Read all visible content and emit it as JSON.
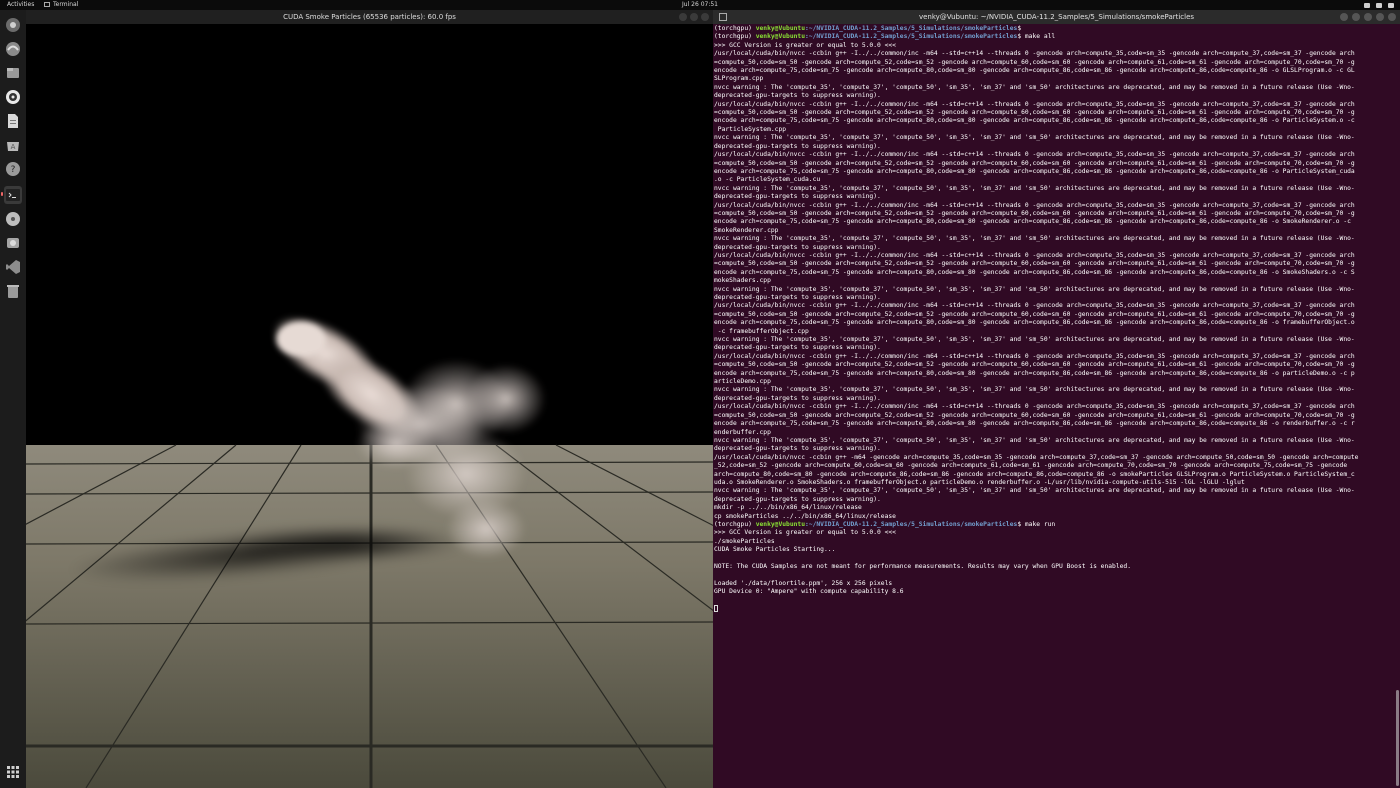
{
  "topbar": {
    "activities": "Activities",
    "app_name": "Terminal",
    "clock": "Jul 26  07:51"
  },
  "dock": {
    "items": [
      "chrome-icon",
      "browser-icon",
      "files-icon",
      "rhythmbox-icon",
      "writer-icon",
      "software-icon",
      "help-icon",
      "terminal-icon",
      "disc-icon",
      "drive-icon",
      "vscode-icon",
      "trash-icon"
    ],
    "show_apps": "show-apps-icon"
  },
  "smoke_window": {
    "title": "CUDA Smoke Particles (65536 particles): 60.0 fps"
  },
  "terminal": {
    "title": "venky@Vubuntu: ~/NVIDIA_CUDA-11.2_Samples/5_Simulations/smokeParticles",
    "lines": [
      {
        "type": "prompt",
        "env": "(torchgpu) ",
        "user": "venky@Vubuntu",
        "path": ":~/NVIDIA_CUDA-11.2_Samples/5_Simulations/smokeParticles",
        "cmd": "$ "
      },
      {
        "type": "prompt",
        "env": "(torchgpu) ",
        "user": "venky@Vubuntu",
        "path": ":~/NVIDIA_CUDA-11.2_Samples/5_Simulations/smokeParticles",
        "cmd": "$ make all"
      },
      {
        "type": "text",
        "text": ">>> GCC Version is greater or equal to 5.0.0 <<<"
      },
      {
        "type": "text",
        "text": "/usr/local/cuda/bin/nvcc -ccbin g++ -I../../common/inc -m64 --std=c++14 --threads 0 -gencode arch=compute_35,code=sm_35 -gencode arch=compute_37,code=sm_37 -gencode arch"
      },
      {
        "type": "text",
        "text": "=compute_50,code=sm_50 -gencode arch=compute_52,code=sm_52 -gencode arch=compute_60,code=sm_60 -gencode arch=compute_61,code=sm_61 -gencode arch=compute_70,code=sm_70 -g"
      },
      {
        "type": "text",
        "text": "encode arch=compute_75,code=sm_75 -gencode arch=compute_80,code=sm_80 -gencode arch=compute_86,code=sm_86 -gencode arch=compute_86,code=compute_86 -o GLSLProgram.o -c GL"
      },
      {
        "type": "text",
        "text": "SLProgram.cpp"
      },
      {
        "type": "text",
        "text": "nvcc warning : The 'compute_35', 'compute_37', 'compute_50', 'sm_35', 'sm_37' and 'sm_50' architectures are deprecated, and may be removed in a future release (Use -Wno-"
      },
      {
        "type": "text",
        "text": "deprecated-gpu-targets to suppress warning)."
      },
      {
        "type": "text",
        "text": "/usr/local/cuda/bin/nvcc -ccbin g++ -I../../common/inc -m64 --std=c++14 --threads 0 -gencode arch=compute_35,code=sm_35 -gencode arch=compute_37,code=sm_37 -gencode arch"
      },
      {
        "type": "text",
        "text": "=compute_50,code=sm_50 -gencode arch=compute_52,code=sm_52 -gencode arch=compute_60,code=sm_60 -gencode arch=compute_61,code=sm_61 -gencode arch=compute_70,code=sm_70 -g"
      },
      {
        "type": "text",
        "text": "encode arch=compute_75,code=sm_75 -gencode arch=compute_80,code=sm_80 -gencode arch=compute_86,code=sm_86 -gencode arch=compute_86,code=compute_86 -o ParticleSystem.o -c"
      },
      {
        "type": "text",
        "text": " ParticleSystem.cpp"
      },
      {
        "type": "text",
        "text": "nvcc warning : The 'compute_35', 'compute_37', 'compute_50', 'sm_35', 'sm_37' and 'sm_50' architectures are deprecated, and may be removed in a future release (Use -Wno-"
      },
      {
        "type": "text",
        "text": "deprecated-gpu-targets to suppress warning)."
      },
      {
        "type": "text",
        "text": "/usr/local/cuda/bin/nvcc -ccbin g++ -I../../common/inc -m64 --std=c++14 --threads 0 -gencode arch=compute_35,code=sm_35 -gencode arch=compute_37,code=sm_37 -gencode arch"
      },
      {
        "type": "text",
        "text": "=compute_50,code=sm_50 -gencode arch=compute_52,code=sm_52 -gencode arch=compute_60,code=sm_60 -gencode arch=compute_61,code=sm_61 -gencode arch=compute_70,code=sm_70 -g"
      },
      {
        "type": "text",
        "text": "encode arch=compute_75,code=sm_75 -gencode arch=compute_80,code=sm_80 -gencode arch=compute_86,code=sm_86 -gencode arch=compute_86,code=compute_86 -o ParticleSystem_cuda"
      },
      {
        "type": "text",
        "text": ".o -c ParticleSystem_cuda.cu"
      },
      {
        "type": "text",
        "text": "nvcc warning : The 'compute_35', 'compute_37', 'compute_50', 'sm_35', 'sm_37' and 'sm_50' architectures are deprecated, and may be removed in a future release (Use -Wno-"
      },
      {
        "type": "text",
        "text": "deprecated-gpu-targets to suppress warning)."
      },
      {
        "type": "text",
        "text": "/usr/local/cuda/bin/nvcc -ccbin g++ -I../../common/inc -m64 --std=c++14 --threads 0 -gencode arch=compute_35,code=sm_35 -gencode arch=compute_37,code=sm_37 -gencode arch"
      },
      {
        "type": "text",
        "text": "=compute_50,code=sm_50 -gencode arch=compute_52,code=sm_52 -gencode arch=compute_60,code=sm_60 -gencode arch=compute_61,code=sm_61 -gencode arch=compute_70,code=sm_70 -g"
      },
      {
        "type": "text",
        "text": "encode arch=compute_75,code=sm_75 -gencode arch=compute_80,code=sm_80 -gencode arch=compute_86,code=sm_86 -gencode arch=compute_86,code=compute_86 -o SmokeRenderer.o -c"
      },
      {
        "type": "text",
        "text": "SmokeRenderer.cpp"
      },
      {
        "type": "text",
        "text": "nvcc warning : The 'compute_35', 'compute_37', 'compute_50', 'sm_35', 'sm_37' and 'sm_50' architectures are deprecated, and may be removed in a future release (Use -Wno-"
      },
      {
        "type": "text",
        "text": "deprecated-gpu-targets to suppress warning)."
      },
      {
        "type": "text",
        "text": "/usr/local/cuda/bin/nvcc -ccbin g++ -I../../common/inc -m64 --std=c++14 --threads 0 -gencode arch=compute_35,code=sm_35 -gencode arch=compute_37,code=sm_37 -gencode arch"
      },
      {
        "type": "text",
        "text": "=compute_50,code=sm_50 -gencode arch=compute_52,code=sm_52 -gencode arch=compute_60,code=sm_60 -gencode arch=compute_61,code=sm_61 -gencode arch=compute_70,code=sm_70 -g"
      },
      {
        "type": "text",
        "text": "encode arch=compute_75,code=sm_75 -gencode arch=compute_80,code=sm_80 -gencode arch=compute_86,code=sm_86 -gencode arch=compute_86,code=compute_86 -o SmokeShaders.o -c S"
      },
      {
        "type": "text",
        "text": "mokeShaders.cpp"
      },
      {
        "type": "text",
        "text": "nvcc warning : The 'compute_35', 'compute_37', 'compute_50', 'sm_35', 'sm_37' and 'sm_50' architectures are deprecated, and may be removed in a future release (Use -Wno-"
      },
      {
        "type": "text",
        "text": "deprecated-gpu-targets to suppress warning)."
      },
      {
        "type": "text",
        "text": "/usr/local/cuda/bin/nvcc -ccbin g++ -I../../common/inc -m64 --std=c++14 --threads 0 -gencode arch=compute_35,code=sm_35 -gencode arch=compute_37,code=sm_37 -gencode arch"
      },
      {
        "type": "text",
        "text": "=compute_50,code=sm_50 -gencode arch=compute_52,code=sm_52 -gencode arch=compute_60,code=sm_60 -gencode arch=compute_61,code=sm_61 -gencode arch=compute_70,code=sm_70 -g"
      },
      {
        "type": "text",
        "text": "encode arch=compute_75,code=sm_75 -gencode arch=compute_80,code=sm_80 -gencode arch=compute_86,code=sm_86 -gencode arch=compute_86,code=compute_86 -o framebufferObject.o"
      },
      {
        "type": "text",
        "text": " -c framebufferObject.cpp"
      },
      {
        "type": "text",
        "text": "nvcc warning : The 'compute_35', 'compute_37', 'compute_50', 'sm_35', 'sm_37' and 'sm_50' architectures are deprecated, and may be removed in a future release (Use -Wno-"
      },
      {
        "type": "text",
        "text": "deprecated-gpu-targets to suppress warning)."
      },
      {
        "type": "text",
        "text": "/usr/local/cuda/bin/nvcc -ccbin g++ -I../../common/inc -m64 --std=c++14 --threads 0 -gencode arch=compute_35,code=sm_35 -gencode arch=compute_37,code=sm_37 -gencode arch"
      },
      {
        "type": "text",
        "text": "=compute_50,code=sm_50 -gencode arch=compute_52,code=sm_52 -gencode arch=compute_60,code=sm_60 -gencode arch=compute_61,code=sm_61 -gencode arch=compute_70,code=sm_70 -g"
      },
      {
        "type": "text",
        "text": "encode arch=compute_75,code=sm_75 -gencode arch=compute_80,code=sm_80 -gencode arch=compute_86,code=sm_86 -gencode arch=compute_86,code=compute_86 -o particleDemo.o -c p"
      },
      {
        "type": "text",
        "text": "articleDemo.cpp"
      },
      {
        "type": "text",
        "text": "nvcc warning : The 'compute_35', 'compute_37', 'compute_50', 'sm_35', 'sm_37' and 'sm_50' architectures are deprecated, and may be removed in a future release (Use -Wno-"
      },
      {
        "type": "text",
        "text": "deprecated-gpu-targets to suppress warning)."
      },
      {
        "type": "text",
        "text": "/usr/local/cuda/bin/nvcc -ccbin g++ -I../../common/inc -m64 --std=c++14 --threads 0 -gencode arch=compute_35,code=sm_35 -gencode arch=compute_37,code=sm_37 -gencode arch"
      },
      {
        "type": "text",
        "text": "=compute_50,code=sm_50 -gencode arch=compute_52,code=sm_52 -gencode arch=compute_60,code=sm_60 -gencode arch=compute_61,code=sm_61 -gencode arch=compute_70,code=sm_70 -g"
      },
      {
        "type": "text",
        "text": "encode arch=compute_75,code=sm_75 -gencode arch=compute_80,code=sm_80 -gencode arch=compute_86,code=sm_86 -gencode arch=compute_86,code=compute_86 -o renderbuffer.o -c r"
      },
      {
        "type": "text",
        "text": "enderbuffer.cpp"
      },
      {
        "type": "text",
        "text": "nvcc warning : The 'compute_35', 'compute_37', 'compute_50', 'sm_35', 'sm_37' and 'sm_50' architectures are deprecated, and may be removed in a future release (Use -Wno-"
      },
      {
        "type": "text",
        "text": "deprecated-gpu-targets to suppress warning)."
      },
      {
        "type": "text",
        "text": "/usr/local/cuda/bin/nvcc -ccbin g++ -m64 -gencode arch=compute_35,code=sm_35 -gencode arch=compute_37,code=sm_37 -gencode arch=compute_50,code=sm_50 -gencode arch=compute"
      },
      {
        "type": "text",
        "text": "_52,code=sm_52 -gencode arch=compute_60,code=sm_60 -gencode arch=compute_61,code=sm_61 -gencode arch=compute_70,code=sm_70 -gencode arch=compute_75,code=sm_75 -gencode"
      },
      {
        "type": "text",
        "text": "arch=compute_80,code=sm_80 -gencode arch=compute_86,code=sm_86 -gencode arch=compute_86,code=compute_86 -o smokeParticles GLSLProgram.o ParticleSystem.o ParticleSystem_c"
      },
      {
        "type": "text",
        "text": "uda.o SmokeRenderer.o SmokeShaders.o framebufferObject.o particleDemo.o renderbuffer.o -L/usr/lib/nvidia-compute-utils-515 -lGL -lGLU -lglut"
      },
      {
        "type": "text",
        "text": "nvcc warning : The 'compute_35', 'compute_37', 'compute_50', 'sm_35', 'sm_37' and 'sm_50' architectures are deprecated, and may be removed in a future release (Use -Wno-"
      },
      {
        "type": "text",
        "text": "deprecated-gpu-targets to suppress warning)."
      },
      {
        "type": "text",
        "text": "mkdir -p ../../bin/x86_64/linux/release"
      },
      {
        "type": "text",
        "text": "cp smokeParticles ../../bin/x86_64/linux/release"
      },
      {
        "type": "prompt",
        "env": "(torchgpu) ",
        "user": "venky@Vubuntu",
        "path": ":~/NVIDIA_CUDA-11.2_Samples/5_Simulations/smokeParticles",
        "cmd": "$ make run"
      },
      {
        "type": "text",
        "text": ">>> GCC Version is greater or equal to 5.0.0 <<<"
      },
      {
        "type": "text",
        "text": "./smokeParticles"
      },
      {
        "type": "text",
        "text": "CUDA Smoke Particles Starting..."
      },
      {
        "type": "text",
        "text": ""
      },
      {
        "type": "text",
        "text": "NOTE: The CUDA Samples are not meant for performance measurements. Results may vary when GPU Boost is enabled."
      },
      {
        "type": "text",
        "text": ""
      },
      {
        "type": "text",
        "text": "Loaded './data/floortile.ppm', 256 x 256 pixels"
      },
      {
        "type": "text",
        "text": "GPU Device 0: \"Ampere\" with compute capability 8.6"
      },
      {
        "type": "text",
        "text": ""
      },
      {
        "type": "cursor"
      }
    ]
  }
}
